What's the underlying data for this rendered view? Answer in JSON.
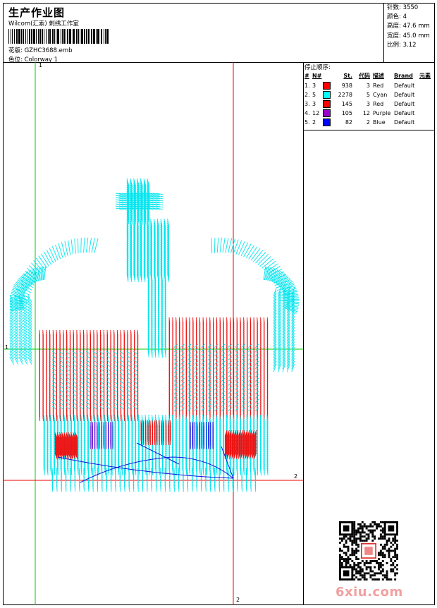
{
  "header": {
    "title": "生产作业图",
    "subtitle": "Wilcom(汇索) 刺绣工作室",
    "design_label": "花版:",
    "design_value": "GZHC3688.emb",
    "color_label": "色位:",
    "color_value": "Colorway 1"
  },
  "stats": [
    {
      "label": "针数:",
      "value": "3550"
    },
    {
      "label": "颜色:",
      "value": "4"
    },
    {
      "label": "高度:",
      "value": "47.6 mm"
    },
    {
      "label": "宽度:",
      "value": "45.0 mm"
    },
    {
      "label": "比例:",
      "value": "3.12"
    }
  ],
  "stop_sequence": {
    "title": "停止顺序:",
    "columns": [
      "#",
      "N#",
      "St.",
      "代码",
      "描述",
      "Brand",
      "元素"
    ],
    "rows": [
      {
        "idx": "1.",
        "n": "3",
        "color": "#ff0000",
        "st": "938",
        "code": "3",
        "desc": "Red",
        "brand": "Default"
      },
      {
        "idx": "2.",
        "n": "5",
        "color": "#00ffff",
        "st": "2278",
        "code": "5",
        "desc": "Cyan",
        "brand": "Default"
      },
      {
        "idx": "3.",
        "n": "3",
        "color": "#ff0000",
        "st": "145",
        "code": "3",
        "desc": "Red",
        "brand": "Default"
      },
      {
        "idx": "4.",
        "n": "12",
        "color": "#9900cc",
        "st": "105",
        "code": "12",
        "desc": "Purple",
        "brand": "Default"
      },
      {
        "idx": "5.",
        "n": "2",
        "color": "#0000ff",
        "st": "82",
        "code": "2",
        "desc": "Blue",
        "brand": "Default"
      }
    ]
  },
  "axes": {
    "top_marker": "1",
    "left_marker": "1",
    "right_marker": "2",
    "bottom_marker": "2"
  },
  "colors": {
    "cyan_thread": "#00e5ee",
    "red_thread": "#ee1111",
    "purple_thread": "#7711cc",
    "blue_thread": "#1111dd",
    "guide_green": "#00cc00",
    "guide_red": "#ee0000"
  },
  "watermark": {
    "logo_text": "6xiu.com"
  }
}
